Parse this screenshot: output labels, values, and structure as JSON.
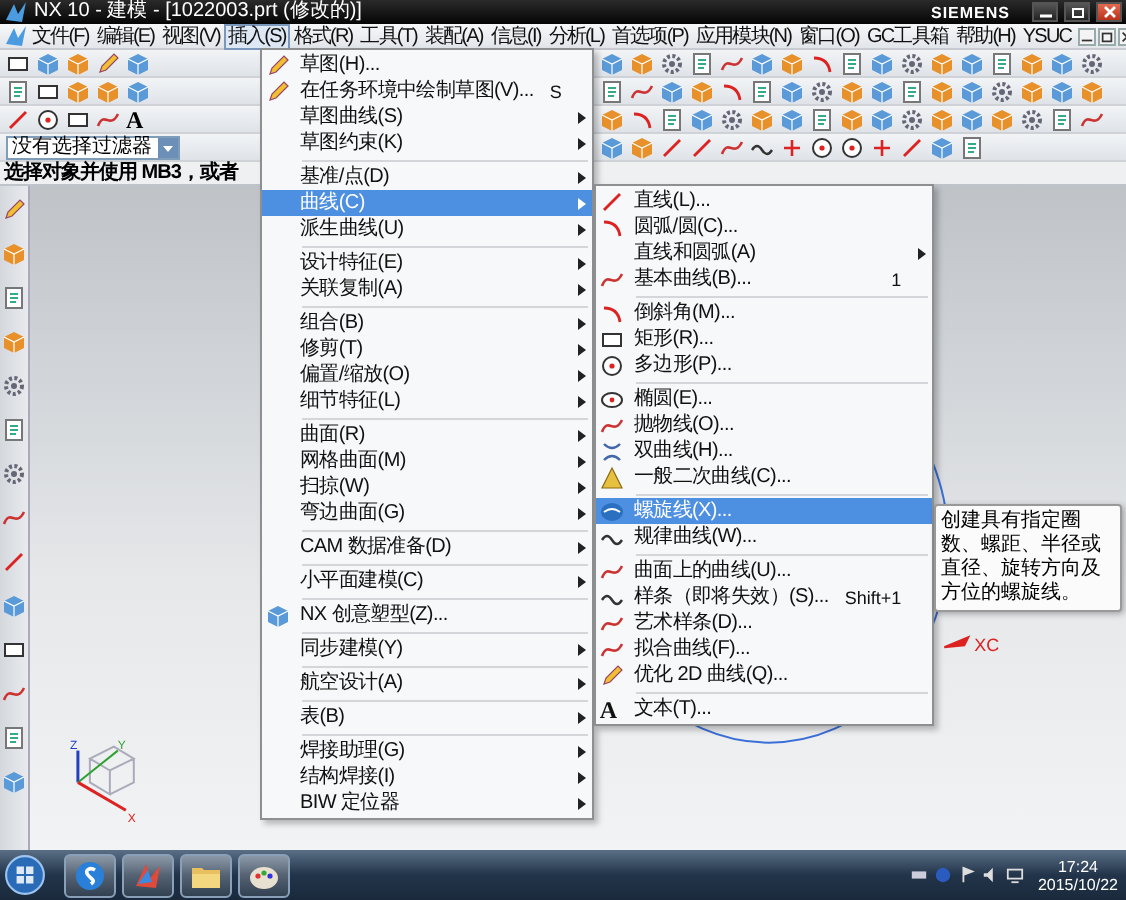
{
  "window": {
    "title": "NX 10 - 建模 - [1022003.prt  (修改的)]",
    "brand": "SIEMENS"
  },
  "menubar": [
    {
      "label": "文件(F)",
      "selected": false
    },
    {
      "label": "编辑(E)",
      "selected": false
    },
    {
      "label": "视图(V)",
      "selected": false
    },
    {
      "label": "插入(S)",
      "selected": true
    },
    {
      "label": "格式(R)",
      "selected": false
    },
    {
      "label": "工具(T)",
      "selected": false
    },
    {
      "label": "装配(A)",
      "selected": false
    },
    {
      "label": "信息(I)",
      "selected": false
    },
    {
      "label": "分析(L)",
      "selected": false
    },
    {
      "label": "首选项(P)",
      "selected": false
    },
    {
      "label": "应用模块(N)",
      "selected": false
    },
    {
      "label": "窗口(O)",
      "selected": false
    },
    {
      "label": "GC工具箱",
      "selected": false
    },
    {
      "label": "帮助(H)",
      "selected": false
    },
    {
      "label": "YSUC",
      "selected": false
    }
  ],
  "toolbar": {
    "text_icon": "A"
  },
  "selection_filter": {
    "value": "没有选择过滤器"
  },
  "status_line": "选择对象并使用 MB3，或者",
  "insert_menu": [
    {
      "kind": "item",
      "label": "草图(H)...",
      "submenu": false,
      "selected": false
    },
    {
      "kind": "item",
      "label": "在任务环境中绘制草图(V)...",
      "shortcut": "S",
      "submenu": false,
      "selected": false
    },
    {
      "kind": "item",
      "label": "草图曲线(S)",
      "submenu": true,
      "selected": false
    },
    {
      "kind": "item",
      "label": "草图约束(K)",
      "submenu": true,
      "selected": false
    },
    {
      "kind": "separator"
    },
    {
      "kind": "item",
      "label": "基准/点(D)",
      "submenu": true,
      "selected": false
    },
    {
      "kind": "item",
      "label": "曲线(C)",
      "submenu": true,
      "selected": true
    },
    {
      "kind": "item",
      "label": "派生曲线(U)",
      "submenu": true,
      "selected": false
    },
    {
      "kind": "separator"
    },
    {
      "kind": "item",
      "label": "设计特征(E)",
      "submenu": true,
      "selected": false
    },
    {
      "kind": "item",
      "label": "关联复制(A)",
      "submenu": true,
      "selected": false
    },
    {
      "kind": "separator"
    },
    {
      "kind": "item",
      "label": "组合(B)",
      "submenu": true,
      "selected": false
    },
    {
      "kind": "item",
      "label": "修剪(T)",
      "submenu": true,
      "selected": false
    },
    {
      "kind": "item",
      "label": "偏置/缩放(O)",
      "submenu": true,
      "selected": false
    },
    {
      "kind": "item",
      "label": "细节特征(L)",
      "submenu": true,
      "selected": false
    },
    {
      "kind": "separator"
    },
    {
      "kind": "item",
      "label": "曲面(R)",
      "submenu": true,
      "selected": false
    },
    {
      "kind": "item",
      "label": "网格曲面(M)",
      "submenu": true,
      "selected": false
    },
    {
      "kind": "item",
      "label": "扫掠(W)",
      "submenu": true,
      "selected": false
    },
    {
      "kind": "item",
      "label": "弯边曲面(G)",
      "submenu": true,
      "selected": false
    },
    {
      "kind": "separator"
    },
    {
      "kind": "item",
      "label": "CAM 数据准备(D)",
      "submenu": true,
      "selected": false
    },
    {
      "kind": "separator"
    },
    {
      "kind": "item",
      "label": "小平面建模(C)",
      "submenu": true,
      "selected": false
    },
    {
      "kind": "separator"
    },
    {
      "kind": "item",
      "label": "NX 创意塑型(Z)...",
      "submenu": false,
      "selected": false
    },
    {
      "kind": "separator"
    },
    {
      "kind": "item",
      "label": "同步建模(Y)",
      "submenu": true,
      "selected": false
    },
    {
      "kind": "separator"
    },
    {
      "kind": "item",
      "label": "航空设计(A)",
      "submenu": true,
      "selected": false
    },
    {
      "kind": "separator"
    },
    {
      "kind": "item",
      "label": "表(B)",
      "submenu": true,
      "selected": false
    },
    {
      "kind": "separator"
    },
    {
      "kind": "item",
      "label": "焊接助理(G)",
      "submenu": true,
      "selected": false
    },
    {
      "kind": "item",
      "label": "结构焊接(I)",
      "submenu": true,
      "selected": false
    },
    {
      "kind": "item",
      "label": "BIW 定位器",
      "submenu": true,
      "selected": false
    }
  ],
  "curve_menu": [
    {
      "kind": "item",
      "label": "直线(L)...",
      "submenu": false,
      "selected": false
    },
    {
      "kind": "item",
      "label": "圆弧/圆(C)...",
      "submenu": false,
      "selected": false
    },
    {
      "kind": "item",
      "label": "直线和圆弧(A)",
      "submenu": true,
      "selected": false
    },
    {
      "kind": "item",
      "label": "基本曲线(B)...",
      "shortcut": "1",
      "submenu": false,
      "selected": false
    },
    {
      "kind": "separator"
    },
    {
      "kind": "item",
      "label": "倒斜角(M)...",
      "submenu": false,
      "selected": false
    },
    {
      "kind": "item",
      "label": "矩形(R)...",
      "submenu": false,
      "selected": false
    },
    {
      "kind": "item",
      "label": "多边形(P)...",
      "submenu": false,
      "selected": false
    },
    {
      "kind": "separator"
    },
    {
      "kind": "item",
      "label": "椭圆(E)...",
      "submenu": false,
      "selected": false
    },
    {
      "kind": "item",
      "label": "抛物线(O)...",
      "submenu": false,
      "selected": false
    },
    {
      "kind": "item",
      "label": "双曲线(H)...",
      "submenu": false,
      "selected": false
    },
    {
      "kind": "item",
      "label": "一般二次曲线(C)...",
      "submenu": false,
      "selected": false
    },
    {
      "kind": "separator"
    },
    {
      "kind": "item",
      "label": "螺旋线(X)...",
      "submenu": false,
      "selected": true
    },
    {
      "kind": "item",
      "label": "规律曲线(W)...",
      "submenu": false,
      "selected": false
    },
    {
      "kind": "separator"
    },
    {
      "kind": "item",
      "label": "曲面上的曲线(U)...",
      "submenu": false,
      "selected": false
    },
    {
      "kind": "item",
      "label": "样条（即将失效）(S)...",
      "shortcut": "Shift+1",
      "submenu": false,
      "selected": false
    },
    {
      "kind": "item",
      "label": "艺术样条(D)...",
      "submenu": false,
      "selected": false
    },
    {
      "kind": "item",
      "label": "拟合曲线(F)...",
      "submenu": false,
      "selected": false
    },
    {
      "kind": "item",
      "label": "优化 2D 曲线(Q)...",
      "submenu": false,
      "selected": false
    },
    {
      "kind": "separator"
    },
    {
      "kind": "item",
      "label": "文本(T)...",
      "icon_text": "A",
      "submenu": false,
      "selected": false
    }
  ],
  "tooltip": "创建具有指定圈数、螺距、半径或直径、旋转方向及方位的螺旋线。",
  "workspace": {
    "axis_label": "XC",
    "triad_labels": [
      "Z",
      "Y",
      "X"
    ]
  },
  "taskbar": {
    "time": "17:24",
    "date": "2015/10/22"
  }
}
